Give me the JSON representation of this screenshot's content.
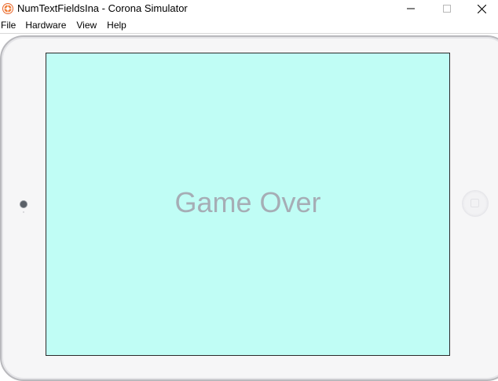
{
  "window": {
    "title": "NumTextFieldsIna - Corona Simulator",
    "controls": {
      "minimize_icon": "minimize-icon",
      "maximize_icon": "maximize-icon",
      "close_icon": "close-icon"
    },
    "app_icon": "corona-app-icon"
  },
  "menubar": {
    "items": [
      {
        "label": "File"
      },
      {
        "label": "Hardware"
      },
      {
        "label": "View"
      },
      {
        "label": "Help"
      }
    ]
  },
  "device": {
    "type": "tablet-landscape",
    "camera_icon": "camera-icon",
    "home_button_icon": "home-button-icon"
  },
  "screen": {
    "background_color": "#c0fdf5",
    "message": "Game Over",
    "message_color": "#a6adb5"
  }
}
